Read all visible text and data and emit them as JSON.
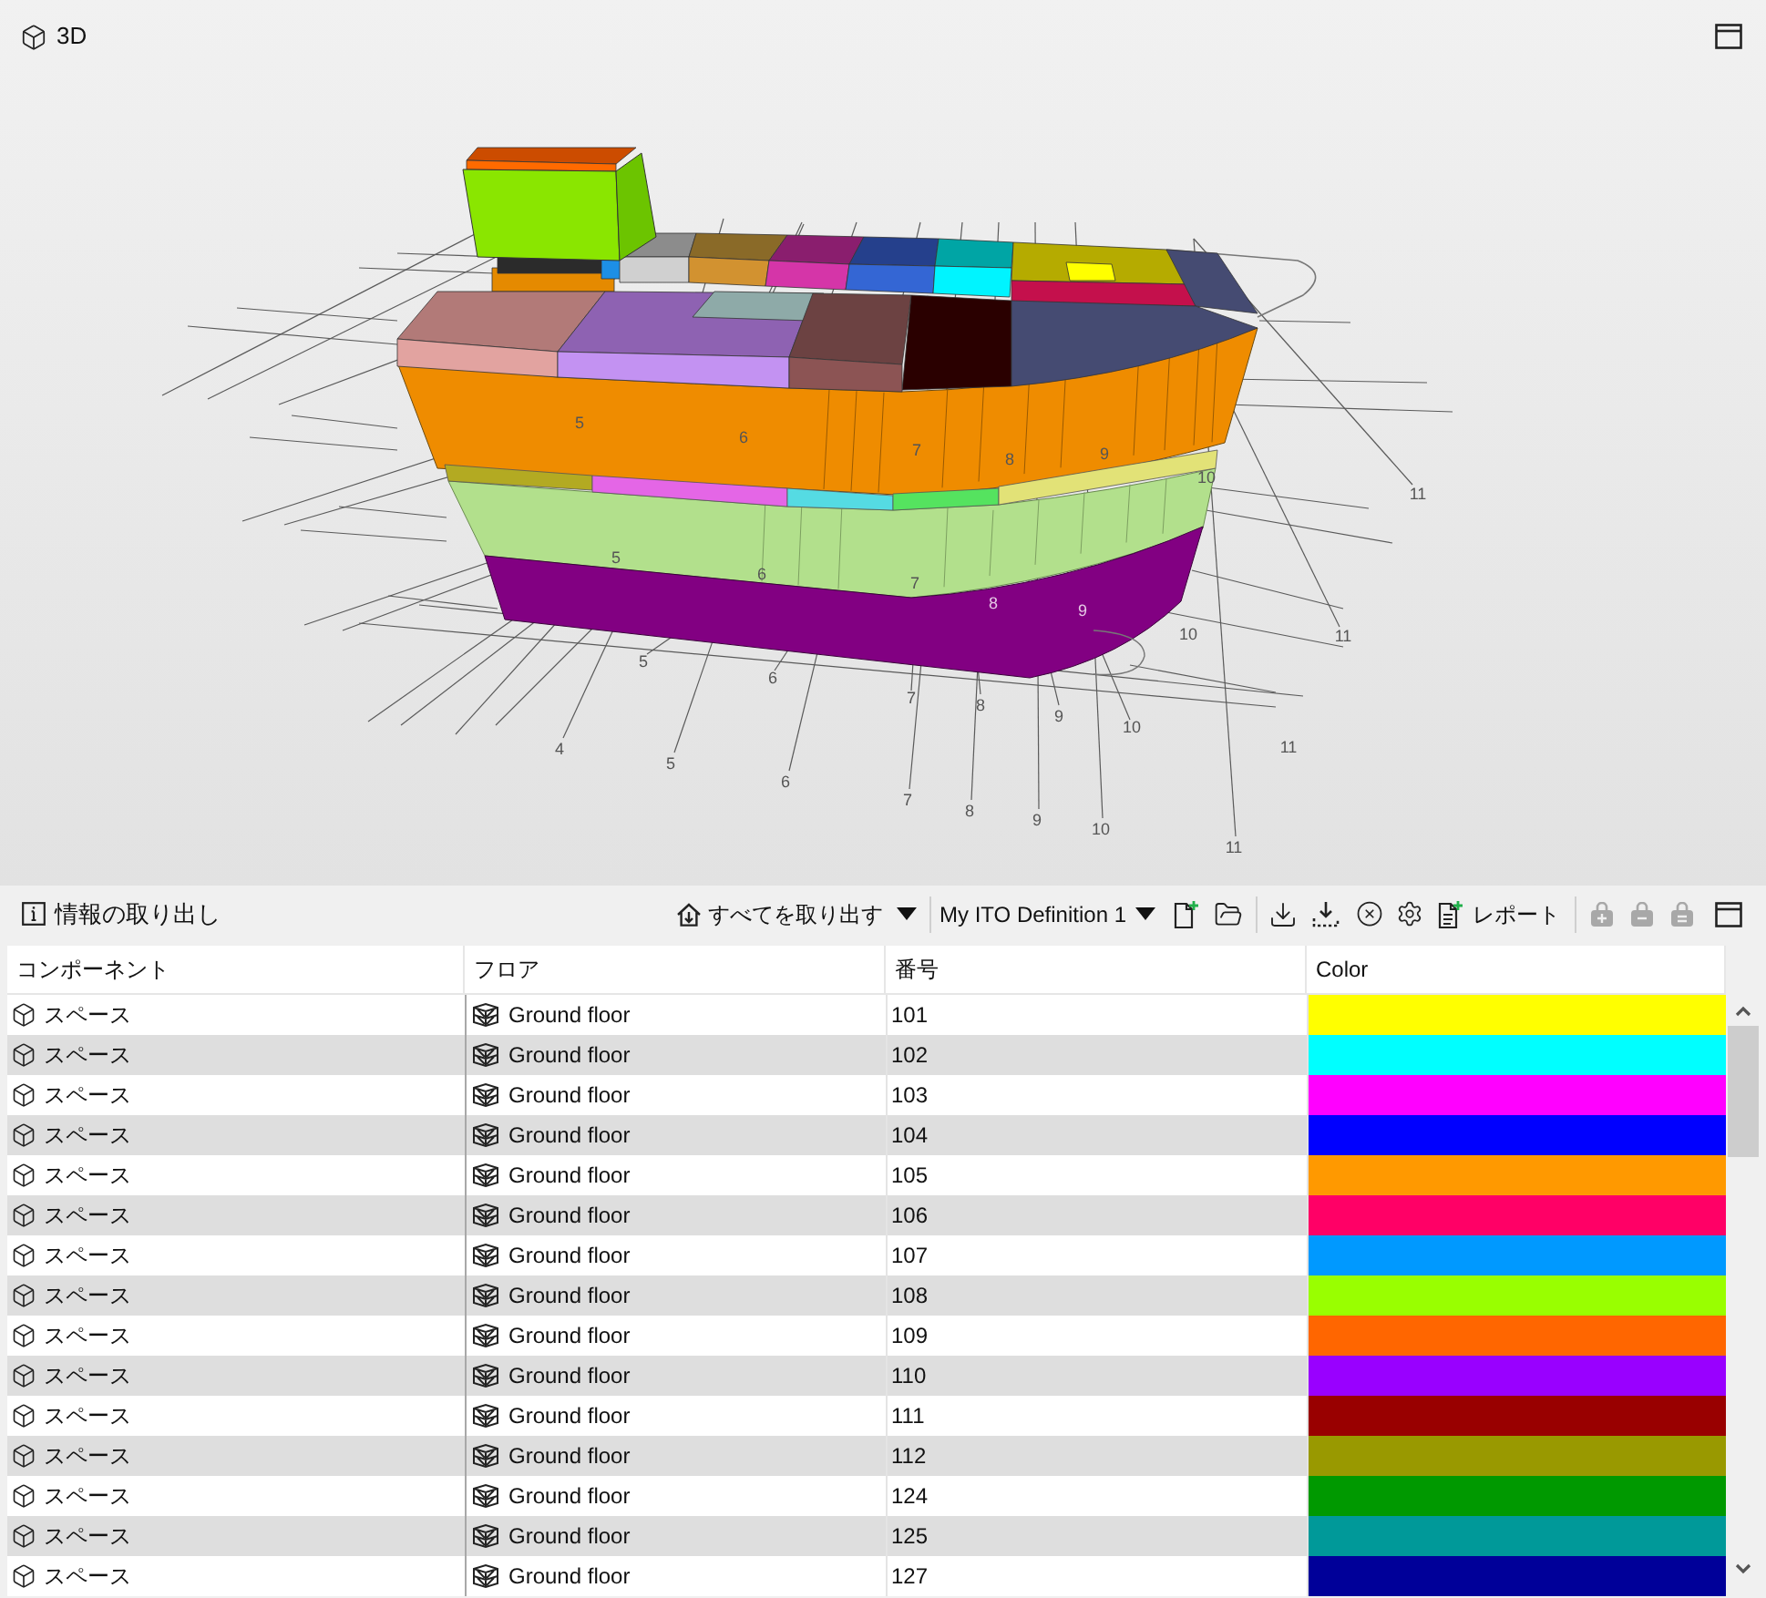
{
  "viewport": {
    "title": "3D",
    "grid_labels": [
      "4",
      "5",
      "6",
      "7",
      "8",
      "9",
      "10",
      "11",
      "5",
      "6",
      "7",
      "8",
      "9",
      "10",
      "11",
      "11",
      "11",
      "10",
      "10",
      "5",
      "6",
      "7",
      "8",
      "9",
      "5",
      "6",
      "7",
      "8",
      "9"
    ]
  },
  "info_panel": {
    "title": "情報の取り出し",
    "extract_all": "すべてを取り出す",
    "definition": "My ITO Definition 1",
    "report": "レポート",
    "bag_buttons": [
      {
        "disabled": true
      },
      {
        "disabled": true
      },
      {
        "disabled": true
      }
    ]
  },
  "table": {
    "columns": [
      "コンポーネント",
      "フロア",
      "番号",
      "Color"
    ],
    "rows": [
      {
        "component": "スペース",
        "floor": "Ground floor",
        "number": "101",
        "color": "#ffff00"
      },
      {
        "component": "スペース",
        "floor": "Ground floor",
        "number": "102",
        "color": "#00ffff"
      },
      {
        "component": "スペース",
        "floor": "Ground floor",
        "number": "103",
        "color": "#ff00ff"
      },
      {
        "component": "スペース",
        "floor": "Ground floor",
        "number": "104",
        "color": "#0000ff"
      },
      {
        "component": "スペース",
        "floor": "Ground floor",
        "number": "105",
        "color": "#ff9900"
      },
      {
        "component": "スペース",
        "floor": "Ground floor",
        "number": "106",
        "color": "#ff0066"
      },
      {
        "component": "スペース",
        "floor": "Ground floor",
        "number": "107",
        "color": "#0099ff"
      },
      {
        "component": "スペース",
        "floor": "Ground floor",
        "number": "108",
        "color": "#99ff00"
      },
      {
        "component": "スペース",
        "floor": "Ground floor",
        "number": "109",
        "color": "#ff6600"
      },
      {
        "component": "スペース",
        "floor": "Ground floor",
        "number": "110",
        "color": "#9900ff"
      },
      {
        "component": "スペース",
        "floor": "Ground floor",
        "number": "111",
        "color": "#990000"
      },
      {
        "component": "スペース",
        "floor": "Ground floor",
        "number": "112",
        "color": "#999900"
      },
      {
        "component": "スペース",
        "floor": "Ground floor",
        "number": "124",
        "color": "#009900"
      },
      {
        "component": "スペース",
        "floor": "Ground floor",
        "number": "125",
        "color": "#009999"
      },
      {
        "component": "スペース",
        "floor": "Ground floor",
        "number": "127",
        "color": "#000099"
      }
    ]
  }
}
